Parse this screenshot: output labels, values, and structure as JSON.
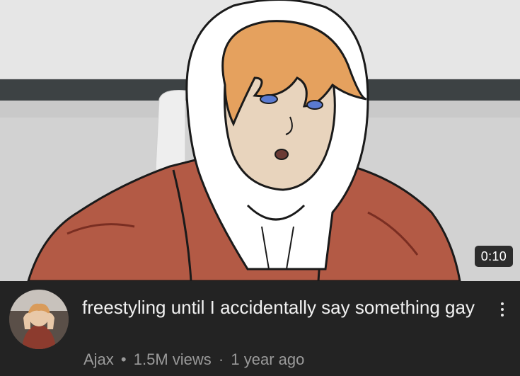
{
  "video": {
    "duration": "0:10",
    "title": "freestyling until I accidentally say something gay",
    "channel": "Ajax",
    "separator": "•",
    "views": "1.5M views",
    "separator2": "·",
    "age": "1 year ago"
  },
  "icons": {
    "more": "vertical-ellipsis-icon"
  },
  "colors": {
    "background": "#232323",
    "title_text": "#f1f1f1",
    "meta_text": "#9a9a9a",
    "duration_bg": "#141414"
  }
}
